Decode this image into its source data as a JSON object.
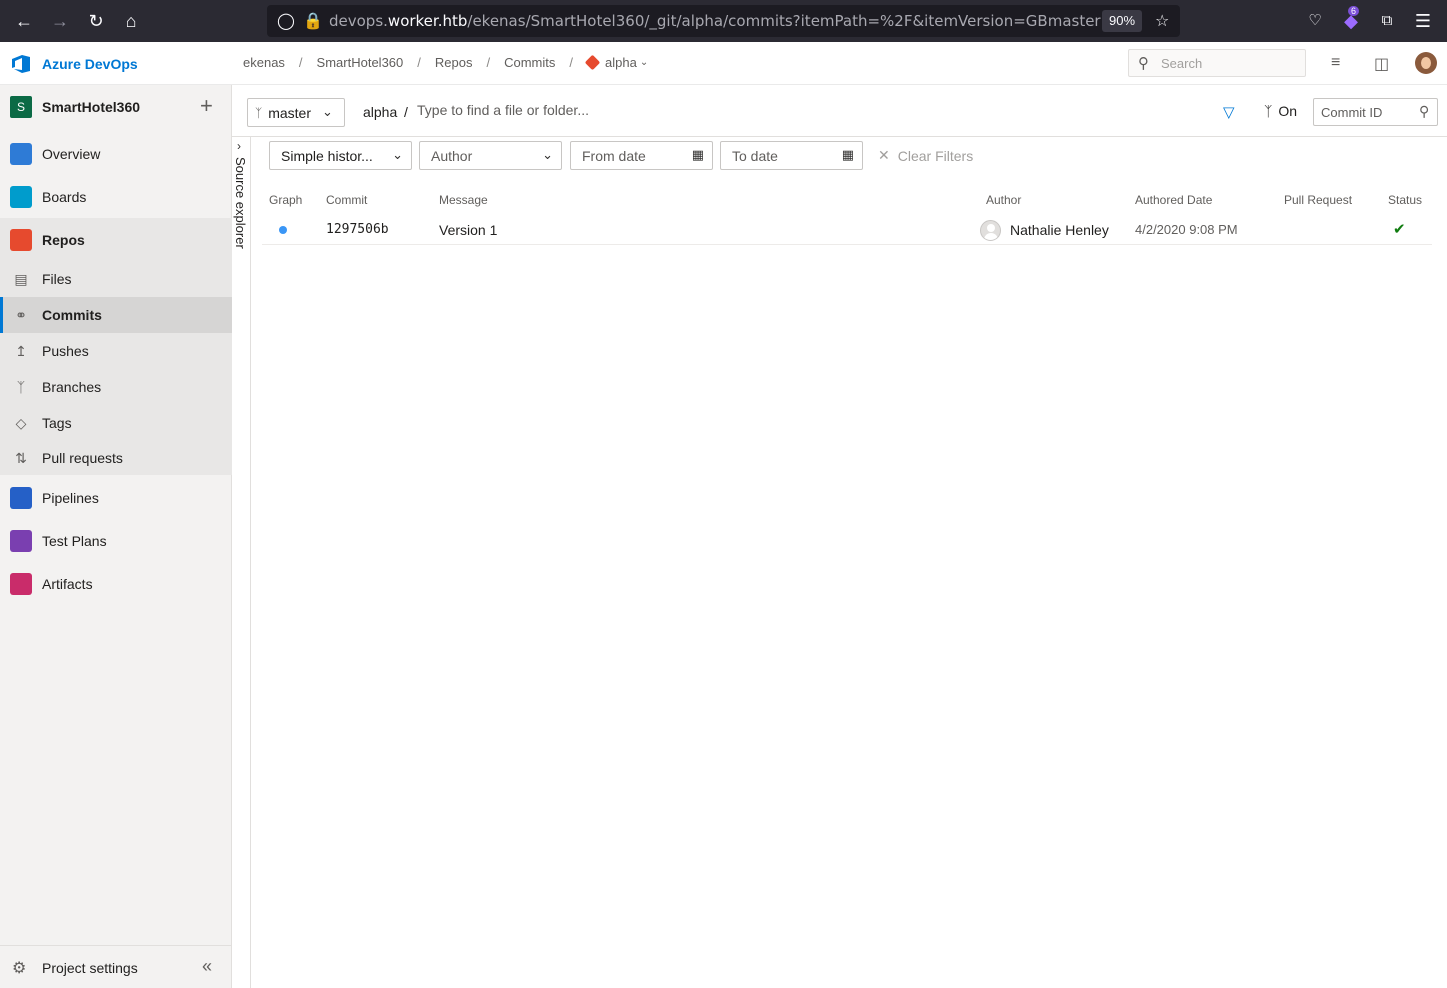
{
  "browser": {
    "url_prefix": "devops.",
    "url_host": "worker.htb",
    "url_path": "/ekenas/SmartHotel360/_git/alpha/commits?itemPath=%2F&itemVersion=GBmaster",
    "zoom": "90%",
    "extension_badge": "6"
  },
  "header": {
    "brand": "Azure DevOps",
    "breadcrumb": [
      "ekenas",
      "SmartHotel360",
      "Repos",
      "Commits",
      "alpha"
    ],
    "search_placeholder": "Search"
  },
  "sidebar": {
    "project_initial": "S",
    "project_name": "SmartHotel360",
    "items": [
      {
        "label": "Overview",
        "color": "#2e7bd6"
      },
      {
        "label": "Boards",
        "color": "#009ccc"
      },
      {
        "label": "Repos",
        "color": "#e64a2e"
      },
      {
        "label": "Pipelines",
        "color": "#2560c7"
      },
      {
        "label": "Test Plans",
        "color": "#7a3fb0"
      },
      {
        "label": "Artifacts",
        "color": "#c92c6a"
      }
    ],
    "repos_sub": [
      {
        "label": "Files",
        "icon": "file-icon"
      },
      {
        "label": "Commits",
        "icon": "commit-icon"
      },
      {
        "label": "Pushes",
        "icon": "push-icon"
      },
      {
        "label": "Branches",
        "icon": "branch-icon"
      },
      {
        "label": "Tags",
        "icon": "tag-icon"
      },
      {
        "label": "Pull requests",
        "icon": "pull-request-icon"
      }
    ],
    "footer_label": "Project settings"
  },
  "source_explorer": "Source explorer",
  "pathbar": {
    "branch": "master",
    "repo": "alpha",
    "separator": "/",
    "path_placeholder": "Type to find a file or folder...",
    "graph_toggle": "On",
    "commit_placeholder": "Commit ID"
  },
  "filters": {
    "history": "Simple histor...",
    "author": "Author",
    "from_date": "From date",
    "to_date": "To date",
    "clear": "Clear Filters"
  },
  "table": {
    "columns": [
      "Graph",
      "Commit",
      "Message",
      "Author",
      "Authored Date",
      "Pull Request",
      "Status"
    ],
    "rows": [
      {
        "commit": "1297506b",
        "message": "Version 1",
        "author": "Nathalie Henley",
        "date": "4/2/2020 9:08 PM",
        "pull_request": "",
        "status": "success"
      }
    ]
  }
}
